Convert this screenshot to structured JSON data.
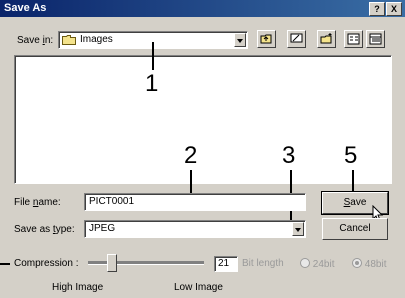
{
  "window": {
    "title": "Save As",
    "help_button": "?",
    "close_button": "X"
  },
  "save_in": {
    "label_pre": "Save ",
    "label_u": "i",
    "label_post": "n:",
    "value": "Images"
  },
  "callouts": {
    "c1": "1",
    "c2": "2",
    "c3": "3",
    "c5": "5"
  },
  "file_name": {
    "label_pre": "File ",
    "label_u": "n",
    "label_post": "ame:",
    "value": "PICT0001"
  },
  "save_as_type": {
    "label_pre": "Save as ",
    "label_u": "t",
    "label_post": "ype:",
    "value": "JPEG"
  },
  "buttons": {
    "save_pre": "",
    "save_u": "S",
    "save_post": "ave",
    "cancel": "Cancel"
  },
  "compression": {
    "label": "Compression :",
    "value": "21",
    "level_fraction": 0.2,
    "bit_length_label": "Bit length",
    "option_24": "24bit",
    "option_48": "48bit",
    "selected_option": "48bit",
    "low_end_label": "High Image",
    "high_end_label": "Low Image"
  }
}
